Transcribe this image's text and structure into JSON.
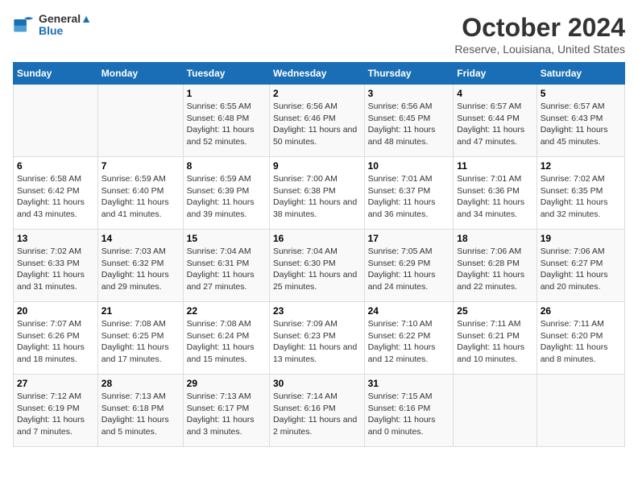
{
  "header": {
    "logo_line1": "General",
    "logo_line2": "Blue",
    "title": "October 2024",
    "location": "Reserve, Louisiana, United States"
  },
  "days_of_week": [
    "Sunday",
    "Monday",
    "Tuesday",
    "Wednesday",
    "Thursday",
    "Friday",
    "Saturday"
  ],
  "weeks": [
    [
      {
        "day": "",
        "info": ""
      },
      {
        "day": "",
        "info": ""
      },
      {
        "day": "1",
        "info": "Sunrise: 6:55 AM\nSunset: 6:48 PM\nDaylight: 11 hours and 52 minutes."
      },
      {
        "day": "2",
        "info": "Sunrise: 6:56 AM\nSunset: 6:46 PM\nDaylight: 11 hours and 50 minutes."
      },
      {
        "day": "3",
        "info": "Sunrise: 6:56 AM\nSunset: 6:45 PM\nDaylight: 11 hours and 48 minutes."
      },
      {
        "day": "4",
        "info": "Sunrise: 6:57 AM\nSunset: 6:44 PM\nDaylight: 11 hours and 47 minutes."
      },
      {
        "day": "5",
        "info": "Sunrise: 6:57 AM\nSunset: 6:43 PM\nDaylight: 11 hours and 45 minutes."
      }
    ],
    [
      {
        "day": "6",
        "info": "Sunrise: 6:58 AM\nSunset: 6:42 PM\nDaylight: 11 hours and 43 minutes."
      },
      {
        "day": "7",
        "info": "Sunrise: 6:59 AM\nSunset: 6:40 PM\nDaylight: 11 hours and 41 minutes."
      },
      {
        "day": "8",
        "info": "Sunrise: 6:59 AM\nSunset: 6:39 PM\nDaylight: 11 hours and 39 minutes."
      },
      {
        "day": "9",
        "info": "Sunrise: 7:00 AM\nSunset: 6:38 PM\nDaylight: 11 hours and 38 minutes."
      },
      {
        "day": "10",
        "info": "Sunrise: 7:01 AM\nSunset: 6:37 PM\nDaylight: 11 hours and 36 minutes."
      },
      {
        "day": "11",
        "info": "Sunrise: 7:01 AM\nSunset: 6:36 PM\nDaylight: 11 hours and 34 minutes."
      },
      {
        "day": "12",
        "info": "Sunrise: 7:02 AM\nSunset: 6:35 PM\nDaylight: 11 hours and 32 minutes."
      }
    ],
    [
      {
        "day": "13",
        "info": "Sunrise: 7:02 AM\nSunset: 6:33 PM\nDaylight: 11 hours and 31 minutes."
      },
      {
        "day": "14",
        "info": "Sunrise: 7:03 AM\nSunset: 6:32 PM\nDaylight: 11 hours and 29 minutes."
      },
      {
        "day": "15",
        "info": "Sunrise: 7:04 AM\nSunset: 6:31 PM\nDaylight: 11 hours and 27 minutes."
      },
      {
        "day": "16",
        "info": "Sunrise: 7:04 AM\nSunset: 6:30 PM\nDaylight: 11 hours and 25 minutes."
      },
      {
        "day": "17",
        "info": "Sunrise: 7:05 AM\nSunset: 6:29 PM\nDaylight: 11 hours and 24 minutes."
      },
      {
        "day": "18",
        "info": "Sunrise: 7:06 AM\nSunset: 6:28 PM\nDaylight: 11 hours and 22 minutes."
      },
      {
        "day": "19",
        "info": "Sunrise: 7:06 AM\nSunset: 6:27 PM\nDaylight: 11 hours and 20 minutes."
      }
    ],
    [
      {
        "day": "20",
        "info": "Sunrise: 7:07 AM\nSunset: 6:26 PM\nDaylight: 11 hours and 18 minutes."
      },
      {
        "day": "21",
        "info": "Sunrise: 7:08 AM\nSunset: 6:25 PM\nDaylight: 11 hours and 17 minutes."
      },
      {
        "day": "22",
        "info": "Sunrise: 7:08 AM\nSunset: 6:24 PM\nDaylight: 11 hours and 15 minutes."
      },
      {
        "day": "23",
        "info": "Sunrise: 7:09 AM\nSunset: 6:23 PM\nDaylight: 11 hours and 13 minutes."
      },
      {
        "day": "24",
        "info": "Sunrise: 7:10 AM\nSunset: 6:22 PM\nDaylight: 11 hours and 12 minutes."
      },
      {
        "day": "25",
        "info": "Sunrise: 7:11 AM\nSunset: 6:21 PM\nDaylight: 11 hours and 10 minutes."
      },
      {
        "day": "26",
        "info": "Sunrise: 7:11 AM\nSunset: 6:20 PM\nDaylight: 11 hours and 8 minutes."
      }
    ],
    [
      {
        "day": "27",
        "info": "Sunrise: 7:12 AM\nSunset: 6:19 PM\nDaylight: 11 hours and 7 minutes."
      },
      {
        "day": "28",
        "info": "Sunrise: 7:13 AM\nSunset: 6:18 PM\nDaylight: 11 hours and 5 minutes."
      },
      {
        "day": "29",
        "info": "Sunrise: 7:13 AM\nSunset: 6:17 PM\nDaylight: 11 hours and 3 minutes."
      },
      {
        "day": "30",
        "info": "Sunrise: 7:14 AM\nSunset: 6:16 PM\nDaylight: 11 hours and 2 minutes."
      },
      {
        "day": "31",
        "info": "Sunrise: 7:15 AM\nSunset: 6:16 PM\nDaylight: 11 hours and 0 minutes."
      },
      {
        "day": "",
        "info": ""
      },
      {
        "day": "",
        "info": ""
      }
    ]
  ]
}
